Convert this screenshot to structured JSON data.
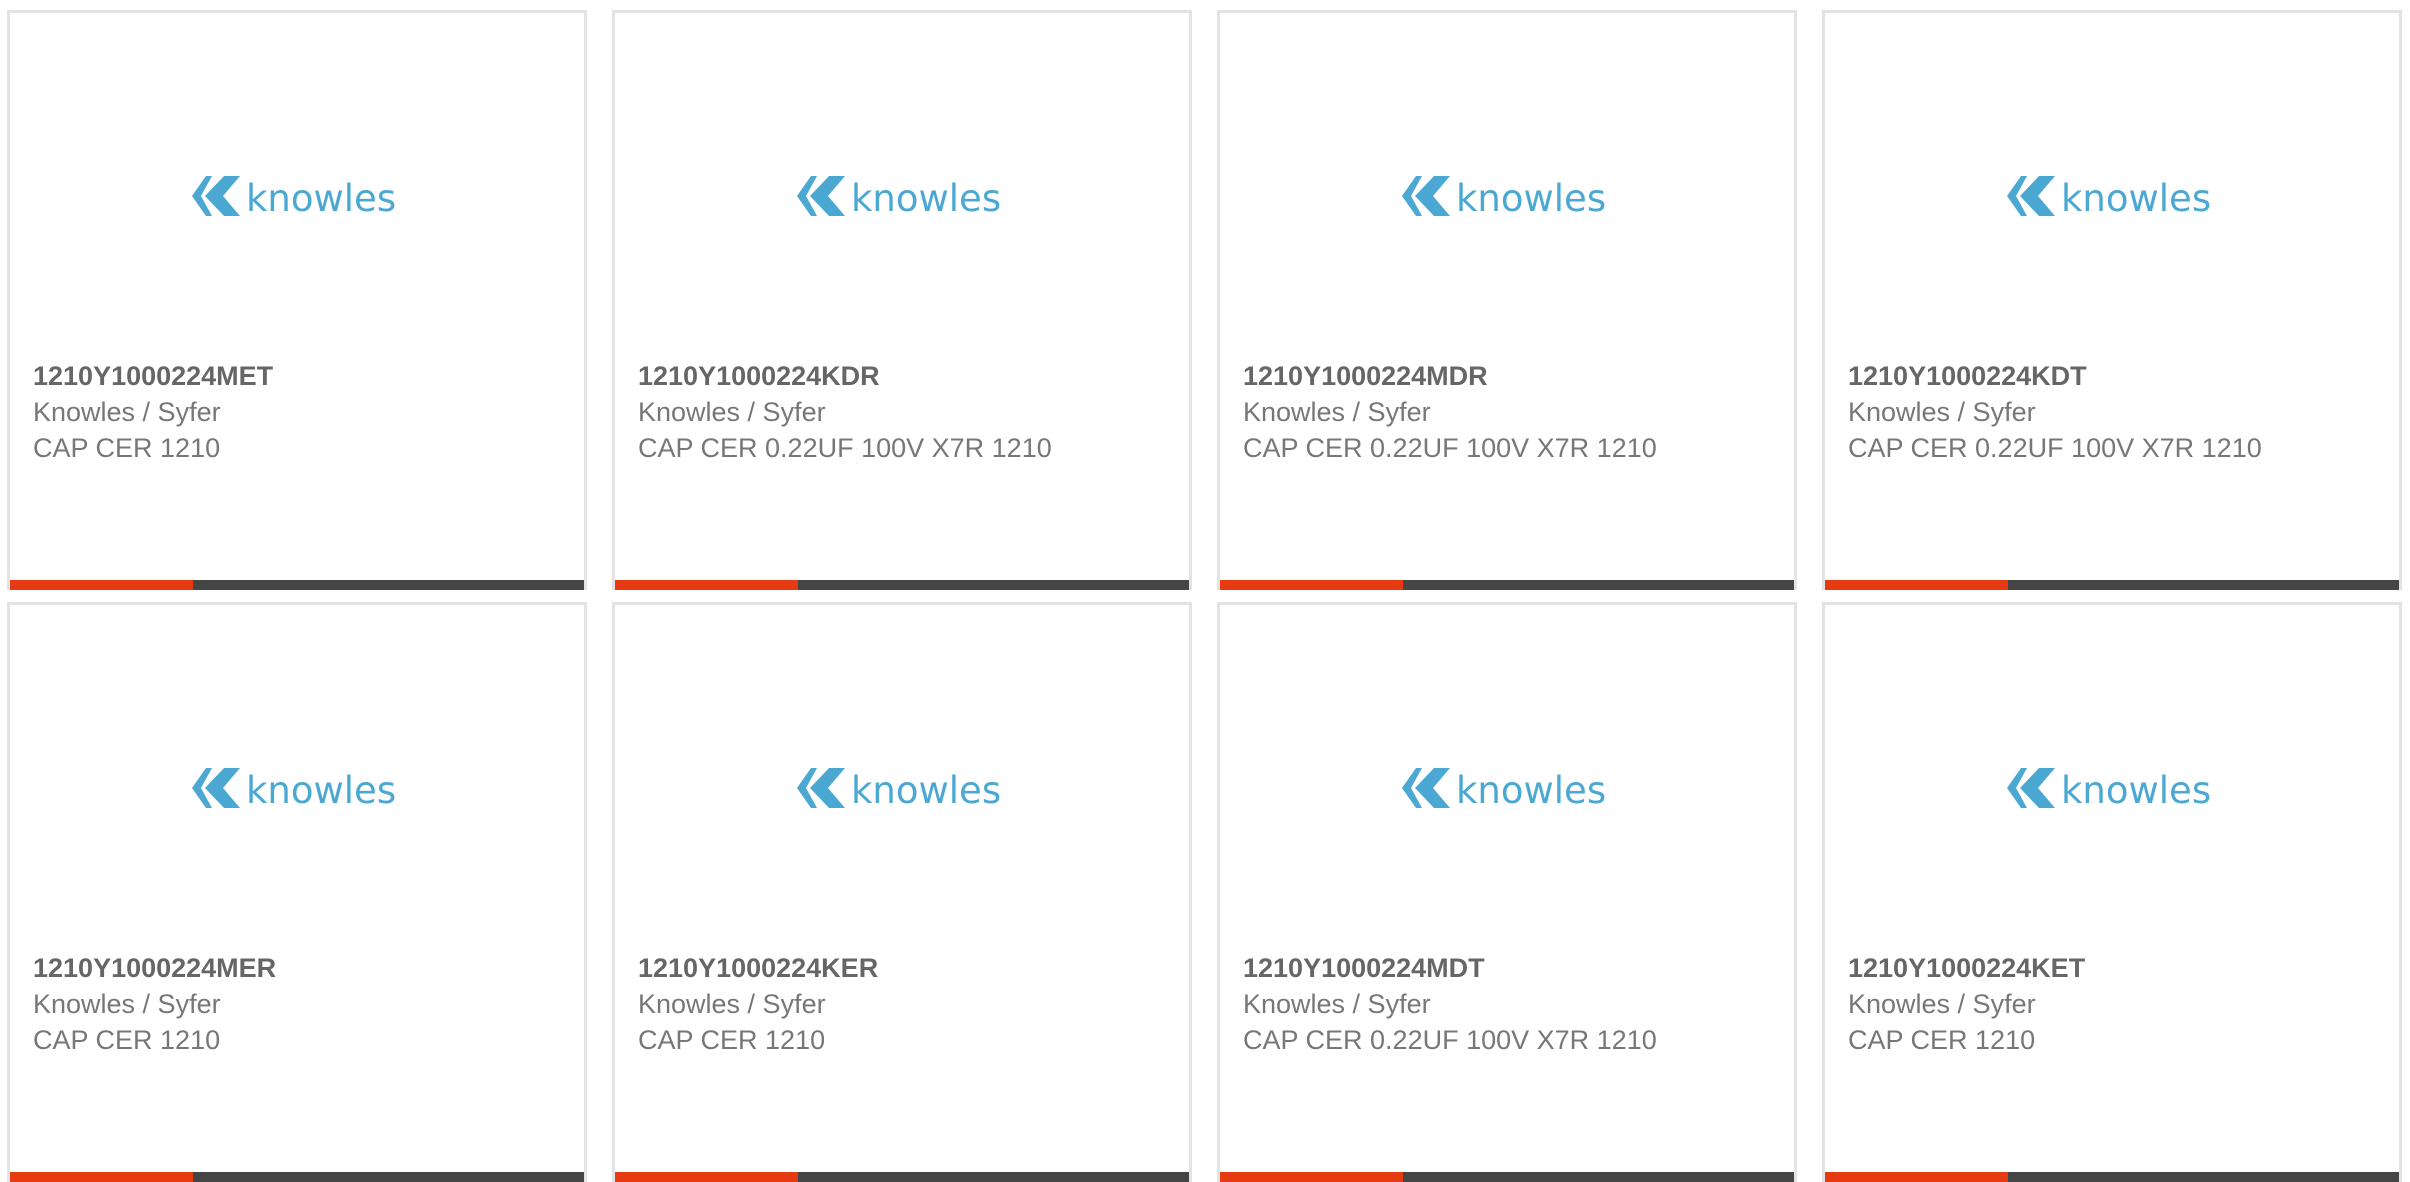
{
  "colors": {
    "brand_blue": "#4ba8d3",
    "accent_red": "#e53a12",
    "bar_dark": "#454545",
    "text_gray": "#777777"
  },
  "cards": [
    {
      "logo_text": "knowles",
      "part_number": "1210Y1000224MET",
      "manufacturer": "Knowles / Syfer",
      "description": "CAP CER 1210"
    },
    {
      "logo_text": "knowles",
      "part_number": "1210Y1000224KDR",
      "manufacturer": "Knowles / Syfer",
      "description": "CAP CER 0.22UF 100V X7R 1210"
    },
    {
      "logo_text": "knowles",
      "part_number": "1210Y1000224MDR",
      "manufacturer": "Knowles / Syfer",
      "description": "CAP CER 0.22UF 100V X7R 1210"
    },
    {
      "logo_text": "knowles",
      "part_number": "1210Y1000224KDT",
      "manufacturer": "Knowles / Syfer",
      "description": "CAP CER 0.22UF 100V X7R 1210"
    },
    {
      "logo_text": "knowles",
      "part_number": "1210Y1000224MER",
      "manufacturer": "Knowles / Syfer",
      "description": "CAP CER 1210"
    },
    {
      "logo_text": "knowles",
      "part_number": "1210Y1000224KER",
      "manufacturer": "Knowles / Syfer",
      "description": "CAP CER 1210"
    },
    {
      "logo_text": "knowles",
      "part_number": "1210Y1000224MDT",
      "manufacturer": "Knowles / Syfer",
      "description": "CAP CER 0.22UF 100V X7R 1210"
    },
    {
      "logo_text": "knowles",
      "part_number": "1210Y1000224KET",
      "manufacturer": "Knowles / Syfer",
      "description": "CAP CER 1210"
    }
  ]
}
